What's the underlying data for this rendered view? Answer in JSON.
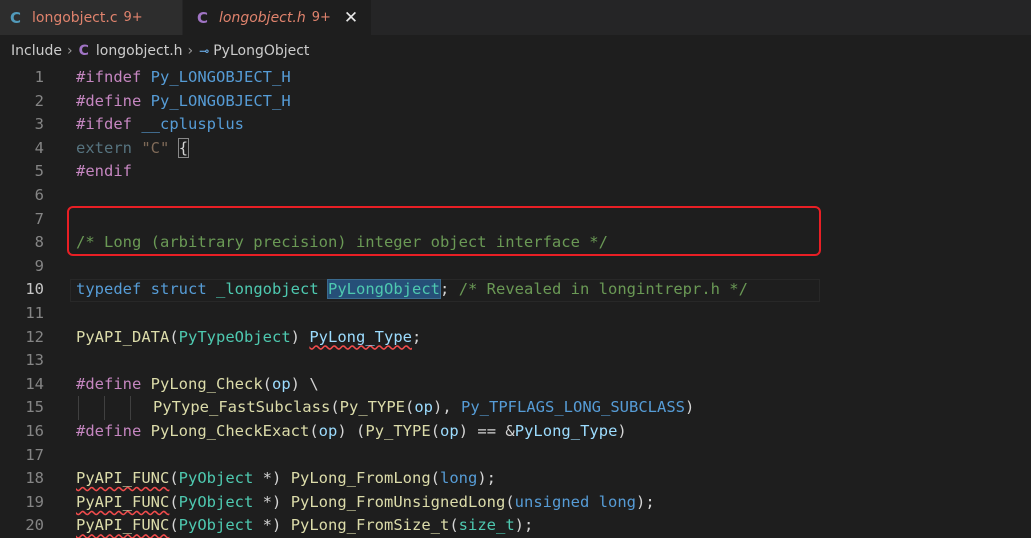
{
  "tabs": [
    {
      "icon": "C",
      "name": "longobject.c",
      "badge": "9+",
      "active": false
    },
    {
      "icon": "C",
      "name": "longobject.h",
      "badge": "9+",
      "active": true,
      "close": "✕"
    }
  ],
  "breadcrumb": {
    "folder": "Include",
    "file_icon": "C",
    "file": "longobject.h",
    "symbol_icon": "⊸",
    "symbol": "PyLongObject"
  },
  "editor": {
    "current_line": 10,
    "line_numbers": [
      "1",
      "2",
      "3",
      "4",
      "5",
      "6",
      "7",
      "8",
      "9",
      "10",
      "11",
      "12",
      "13",
      "14",
      "15",
      "16",
      "17",
      "18",
      "19",
      "20"
    ]
  },
  "code": {
    "l1": [
      "#ifndef",
      "Py_LONGOBJECT_H"
    ],
    "l2": [
      "#define",
      "Py_LONGOBJECT_H"
    ],
    "l3": [
      "#ifdef",
      "__cplusplus"
    ],
    "l4": [
      "extern",
      "\"C\"",
      "{"
    ],
    "l5": [
      "#endif"
    ],
    "l8": [
      "/* Long (arbitrary precision) integer object interface */"
    ],
    "l10": [
      "typedef",
      "struct",
      "_longobject",
      "PyLongObject",
      ";",
      "/* Revealed in longintrepr.h */"
    ],
    "l12": [
      "PyAPI_DATA",
      "(",
      "PyTypeObject",
      ")",
      "PyLong_Type",
      ";"
    ],
    "l14": [
      "#define",
      "PyLong_Check",
      "(",
      "op",
      ")",
      "\\"
    ],
    "l15": [
      "PyType_FastSubclass",
      "(",
      "Py_TYPE",
      "(",
      "op",
      "),",
      "Py_TPFLAGS_LONG_SUBCLASS",
      ")"
    ],
    "l16": [
      "#define",
      "PyLong_CheckExact",
      "(",
      "op",
      ")",
      "(",
      "Py_TYPE",
      "(",
      "op",
      ")",
      "==",
      "&",
      "PyLong_Type",
      ")"
    ],
    "l18": [
      "PyAPI_FUNC",
      "(",
      "PyObject",
      "*)",
      "PyLong_FromLong",
      "(",
      "long",
      ");"
    ],
    "l19": [
      "PyAPI_FUNC",
      "(",
      "PyObject",
      "*)",
      "PyLong_FromUnsignedLong",
      "(",
      "unsigned",
      "long",
      ");"
    ],
    "l20": [
      "PyAPI_FUNC",
      "(",
      "PyObject",
      "*)",
      "PyLong_FromSize_t",
      "(",
      "size_t",
      ");"
    ]
  },
  "colors": {
    "background": "#1e1e1e",
    "annotation_box": "#e81f25",
    "comment": "#6a9955",
    "preprocessor": "#c586c0",
    "function": "#dcdcaa",
    "type": "#4ec9b0"
  }
}
